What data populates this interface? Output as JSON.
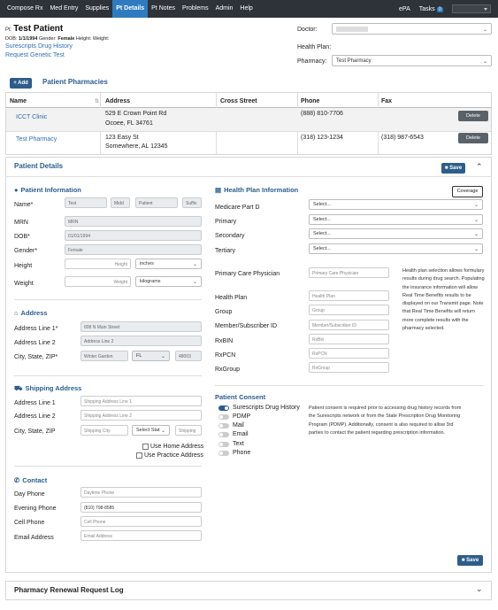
{
  "nav": {
    "items": [
      "Compose Rx",
      "Med Entry",
      "Supplies",
      "Pt Details",
      "Pt Notes",
      "Problems",
      "Admin",
      "Help"
    ],
    "epa": "ePA",
    "tasks": "Tasks",
    "tasks_count": "0"
  },
  "patient": {
    "pt_label": "Pt:",
    "name": "Test Patient",
    "dob_label": "DOB:",
    "dob": "1/1/1994",
    "gender_label": "Gender:",
    "gender": "Female",
    "height_label": "Height:",
    "weight_label": "Weight:",
    "link1": "Surescripts Drug History",
    "link2": "Request Genetic Test"
  },
  "header_right": {
    "doctor_label": "Doctor:",
    "doctor_value": "",
    "health_plan_label": "Health Plan:",
    "pharmacy_label": "Pharmacy:",
    "pharmacy_value": "Test Pharmacy"
  },
  "pharmacies": {
    "add_label": "+ Add",
    "title": "Patient Pharmacies",
    "columns": [
      "Name",
      "Address",
      "Cross Street",
      "Phone",
      "Fax"
    ],
    "rows": [
      {
        "name": "ICCT Clinic",
        "addr1": "529 E Crown Point Rd",
        "addr2": "Ocoee, FL 34761",
        "cross": "",
        "phone": "(888) 810-7706",
        "fax": "",
        "action": "Delete"
      },
      {
        "name": "Test Pharmacy",
        "addr1": "123 Easy St",
        "addr2": "Somewhere, AL 12345",
        "cross": "",
        "phone": "(318) 123-1234",
        "fax": "(318) 987-6543",
        "action": "Delete"
      }
    ]
  },
  "details": {
    "title": "Patient Details",
    "save": "Save",
    "patient_info": {
      "title": "Patient Information",
      "name_label": "Name*",
      "first": "Test",
      "middle": "Midd",
      "last": "Patient",
      "suffix": "Suffix",
      "mrn_label": "MRN",
      "mrn": "MRN",
      "dob_label": "DOB*",
      "dob": "01/01/1994",
      "gender_label": "Gender*",
      "gender": "Female",
      "height_label": "Height",
      "height_ph": "Height",
      "height_unit": "inches",
      "weight_label": "Weight",
      "weight_ph": "Weight",
      "weight_unit": "kilograms"
    },
    "address": {
      "title": "Address",
      "line1_label": "Address Line 1*",
      "line1": "608 N Main Street",
      "line2_label": "Address Line 2",
      "line2": "Address Line 2",
      "csz_label": "City, State, ZIP*",
      "city": "Winter Garden",
      "state": "FL",
      "zip": "48003"
    },
    "shipping": {
      "title": "Shipping Address",
      "line1_label": "Address Line 1",
      "line1": "Shipping Address Line 1",
      "line2_label": "Address Line 2",
      "line2": "Shipping Address Line 2",
      "csz_label": "City, State, ZIP",
      "city": "Shipping City",
      "state": "Select Stat",
      "zip": "Shipping",
      "use_home": "Use Home Address",
      "use_practice": "Use Practice Address"
    },
    "contact": {
      "title": "Contact",
      "day_label": "Day Phone",
      "day": "Daytime Phone",
      "evening_label": "Evening Phone",
      "evening": "(810) 798-8585",
      "cell_label": "Cell Phone",
      "cell": "Cell Phone",
      "email_label": "Email Address",
      "email": "Email Address"
    },
    "health_plan": {
      "title": "Health Plan Information",
      "coverage": "Coverage",
      "medicare_label": "Medicare Part D",
      "primary_label": "Primary",
      "secondary_label": "Secondary",
      "tertiary_label": "Tertiary",
      "select": "Select...",
      "pcp_label": "Primary Care Physician",
      "pcp": "Primary Care Physician",
      "plan_label": "Health Plan",
      "plan": "Health Plan",
      "group_label": "Group",
      "group": "Group",
      "member_label": "Member/Subscriber ID",
      "member": "Member/Subscriber ID",
      "rxbin_label": "RxBIN",
      "rxbin": "RxBin",
      "rxpcn_label": "RxPCN",
      "rxpcn": "RxPCN",
      "rxgroup_label": "RxGroup",
      "rxgroup": "RxGroup",
      "note": "Health plan selection allows formulary results during drug search. Populating the insurance information will allow Real Time Benefits results to be displayed on our Transmit page. Note that Real Time Benefits will return more complete results with the pharmacy selected."
    },
    "consent": {
      "title": "Patient Consent",
      "items": [
        "Surescripts Drug History",
        "PDMP",
        "Mail",
        "Email",
        "Text",
        "Phone"
      ],
      "note": "Patient consent is required prior to accessing drug history records from the Surescripts network or from the State Prescription Drug Monitoring Program (PDMP). Additionally, consent is also required to allow 3rd parties to contact the patient regarding prescription information."
    },
    "save_bottom": "Save"
  },
  "renewal": {
    "title": "Pharmacy Renewal Request Log"
  },
  "colors": {
    "nav_bg": "#2d3339",
    "accent": "#2f7bbf",
    "button": "#2d5d8a",
    "link": "#2f6db5"
  }
}
